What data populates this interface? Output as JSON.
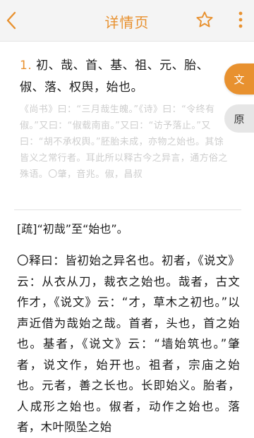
{
  "header": {
    "title": "详情页"
  },
  "entry": {
    "number": "1.",
    "text": "初、哉、首、基、祖、元、胎、俶、落、权舆，始也。"
  },
  "side_buttons": {
    "wen": "文",
    "yuan": "原"
  },
  "note": "《尚书》曰：“三月哉生魄。”《诗》曰：“令终有俶。”又曰：“俶载南亩。”又曰：“访予落止。”又曰：“胡不承权舆。”胚胎未成，亦物之始也。其馀皆义之常行者。耳此所以释古今之异言，通方俗之殊语。〇肇，音兆。俶，昌叔",
  "shu": "[疏]“初哉”至“始也”。",
  "explanation": "〇释曰：皆初始之异名也。初者，《说文》云：从衣从刀，裁衣之始也。哉者，古文作才，《说文》云：“才，草木之初也。”以声近借为哉始之哉。首者，头也，首之始也。基者，《说文》云：“墙始筑也。”肇者，说文作，始开也。祖者，宗庙之始也。元者，善之长也。长即始义。胎者，人成形之始也。俶者，动作之始也。落者，木叶陨坠之始"
}
